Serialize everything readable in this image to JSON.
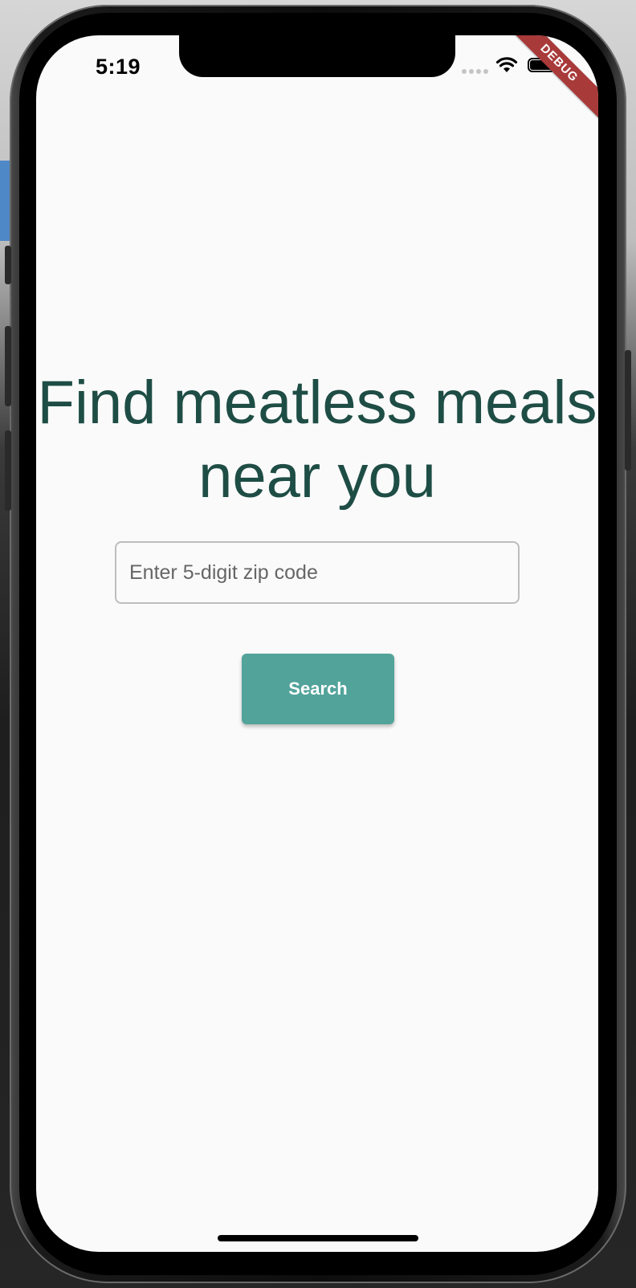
{
  "status_bar": {
    "time": "5:19",
    "icons": [
      "cellular-signal-icon",
      "wifi-icon",
      "battery-icon"
    ]
  },
  "debug_banner": {
    "label": "DEBUG",
    "color": "#a83a3a"
  },
  "main": {
    "headline": "Find meatless meals near you",
    "headline_color": "#1e4d45",
    "zip_input": {
      "value": "",
      "placeholder": "Enter 5-digit zip code"
    },
    "search_button": {
      "label": "Search",
      "color": "#52a39a"
    }
  },
  "colors": {
    "screen_background": "#fafafa",
    "accent": "#52a39a"
  }
}
